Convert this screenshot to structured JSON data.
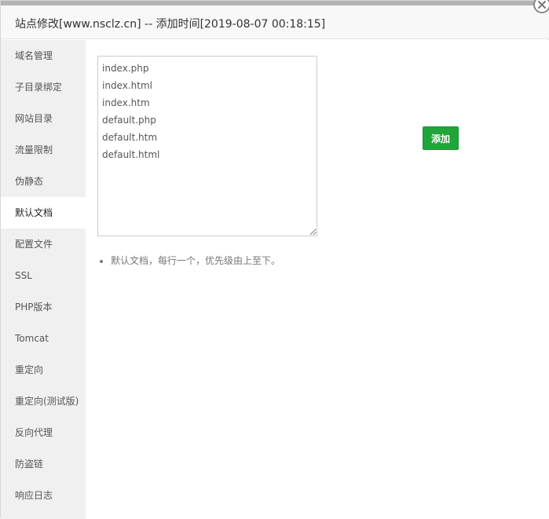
{
  "title": "站点修改[www.nsclz.cn] -- 添加时间[2019-08-07 00:18:15]",
  "sidebar": {
    "items": [
      {
        "label": "域名管理"
      },
      {
        "label": "子目录绑定"
      },
      {
        "label": "网站目录"
      },
      {
        "label": "流量限制"
      },
      {
        "label": "伪静态"
      },
      {
        "label": "默认文档",
        "active": true
      },
      {
        "label": "配置文件"
      },
      {
        "label": "SSL"
      },
      {
        "label": "PHP版本"
      },
      {
        "label": "Tomcat"
      },
      {
        "label": "重定向"
      },
      {
        "label": "重定向(测试版)"
      },
      {
        "label": "反向代理"
      },
      {
        "label": "防盗链"
      },
      {
        "label": "响应日志"
      }
    ]
  },
  "main": {
    "default_documents": "index.php\nindex.html\nindex.htm\ndefault.php\ndefault.htm\ndefault.html",
    "add_label": "添加",
    "tips": [
      "默认文档，每行一个，优先级由上至下。"
    ]
  },
  "colors": {
    "accent_green": "#20a53a",
    "sidebar_bg": "#f0f0f0"
  },
  "icons": {
    "close": "close-icon"
  }
}
